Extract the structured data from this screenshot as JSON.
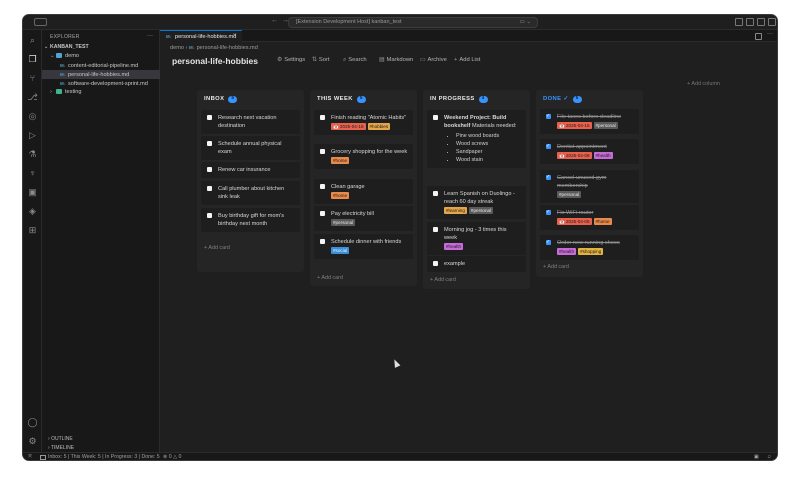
{
  "window": {
    "title": "[Extension Development Host] kanban_test"
  },
  "sidebar": {
    "header": "EXPLORER",
    "workspace": "KANBAN_TEST",
    "tree": [
      {
        "label": "demo",
        "type": "folder",
        "depth": 1
      },
      {
        "label": "content-editorial-pipeline.md",
        "type": "file",
        "depth": 2
      },
      {
        "label": "personal-life-hobbies.md",
        "type": "file",
        "depth": 2,
        "selected": true
      },
      {
        "label": "software-development-sprint.md",
        "type": "file",
        "depth": 2
      },
      {
        "label": "testing",
        "type": "folder",
        "depth": 1
      }
    ],
    "outline": "OUTLINE",
    "timeline": "TIMELINE"
  },
  "editor": {
    "tab_label": "personal-life-hobbies.md",
    "file_badge": "M↓",
    "breadcrumb": {
      "folder": "demo",
      "sep": "›",
      "file": "personal-life-hobbies.md"
    }
  },
  "board": {
    "title": "personal-life-hobbies",
    "actions": {
      "settings": "Settings",
      "sort": "Sort",
      "search": "Search",
      "markdown": "Markdown",
      "archive": "Archive",
      "add_list": "Add List"
    },
    "add_column": "+ Add column",
    "add_card": "+ Add card",
    "columns": [
      {
        "title": "INBOX",
        "count": "5",
        "cards": [
          {
            "text": "Research next vacation destination"
          },
          {
            "text": "Schedule annual physical exam"
          },
          {
            "text": "Renew car insurance"
          },
          {
            "text": "Call plumber about kitchen sink leak"
          },
          {
            "text": "Buy birthday gift for mom's birthday next month"
          }
        ]
      },
      {
        "title": "THIS WEEK",
        "count": "5",
        "cards": [
          {
            "text": "Finish reading \"Atomic Habits\"",
            "date": "📅 2025-04-16",
            "tags": [
              "#hobbies"
            ]
          },
          {
            "text": "Grocery shopping for the week",
            "tags": [
              "#home"
            ]
          },
          {
            "text": "Clean garage",
            "tags": [
              "#home"
            ]
          },
          {
            "text": "Pay electricity bill",
            "tags": [
              "#personal"
            ]
          },
          {
            "text": "Schedule dinner with friends",
            "tags": [
              "#social"
            ]
          }
        ]
      },
      {
        "title": "IN PROGRESS",
        "count": "4",
        "cards": [
          {
            "bold": "Weekend Project: Build bookshelf",
            "text": " Materials needed:",
            "bullets": [
              "Pine wood boards",
              "Wood screws",
              "Sandpaper",
              "Wood stain"
            ]
          },
          {
            "text": "Learn Spanish on Duolingo - reach 60 day streak",
            "tags": [
              "#learning",
              "#personal"
            ]
          },
          {
            "text": "Morning jog - 3 times this week",
            "tags": [
              "#health"
            ]
          },
          {
            "text": "example"
          }
        ]
      },
      {
        "title": "DONE",
        "check": "✓",
        "count": "5",
        "cards": [
          {
            "text": "File taxes before deadline",
            "date": "📅 2025-04-15",
            "tags": [
              "#personal"
            ]
          },
          {
            "text": "Dentist appointment",
            "date": "📅 2025-04-08",
            "tags": [
              "#health"
            ]
          },
          {
            "text": "Cancel unused gym membership",
            "tags": [
              "#personal"
            ]
          },
          {
            "text": "Fix WiFi router",
            "date": "📅 2025-04-05",
            "tags": [
              "#home"
            ]
          },
          {
            "text": "Order new running shoes",
            "tags": [
              "#health",
              "#shopping"
            ]
          }
        ]
      }
    ]
  },
  "statusbar": {
    "summary": "Inbox: 5 | This Week: 5 | In Progress: 3 | Done: 5",
    "problems": "⊗ 0 △ 0"
  },
  "colors": {
    "accent": "#3794ff",
    "tag_date": "#e8614d",
    "tag_hobbies": "#e5a54b",
    "tag_home": "#e98a4a",
    "tag_personal": "#5a5a5a",
    "tag_social": "#3b8ed8",
    "tag_health": "#c76bd8",
    "tag_shopping": "#e3b341"
  }
}
